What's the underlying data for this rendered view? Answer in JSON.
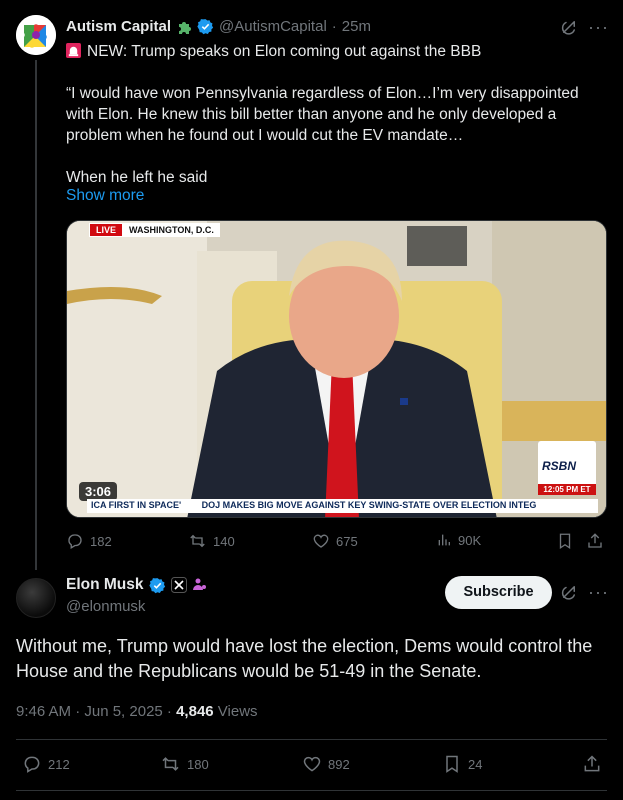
{
  "tweet1": {
    "author_name": "Autism Capital",
    "author_handle": "@AutismCapital",
    "time": "25m",
    "headline": "NEW: Trump speaks on Elon coming out against the BBB",
    "body_quote": "“I would have won Pennsylvania regardless of Elon…I’m very disappointed with Elon. He knew this bill better than anyone and he only developed a problem when he found out I would cut the EV mandate…",
    "body_tail": "When he left he said",
    "show_more": "Show more",
    "media": {
      "live_label": "LIVE",
      "location": "WASHINGTON, D.C.",
      "timecode": "3:06",
      "ticker_left": "ICA FIRST IN SPACE'",
      "ticker_main": "DOJ MAKES BIG MOVE AGAINST KEY SWING-STATE OVER ELECTION INTEG",
      "network": "RSBN",
      "clock": "12:05 PM ET"
    },
    "stats": {
      "replies": "182",
      "reposts": "140",
      "likes": "675",
      "views": "90K"
    }
  },
  "tweet2": {
    "author_name": "Elon Musk",
    "author_handle": "@elonmusk",
    "subscribe_label": "Subscribe",
    "body": "Without me, Trump would have lost the election, Dems would control the House and the Republicans would be 51-49 in the Senate.",
    "timestamp": "9:46 AM · Jun 5, 2025 · ",
    "views_count": "4,846",
    "views_label": " Views",
    "stats": {
      "replies": "212",
      "reposts": "180",
      "likes": "892",
      "bookmarks": "24"
    }
  },
  "colors": {
    "accent": "#1d9bf0",
    "muted": "#71767b",
    "background": "#000000"
  }
}
